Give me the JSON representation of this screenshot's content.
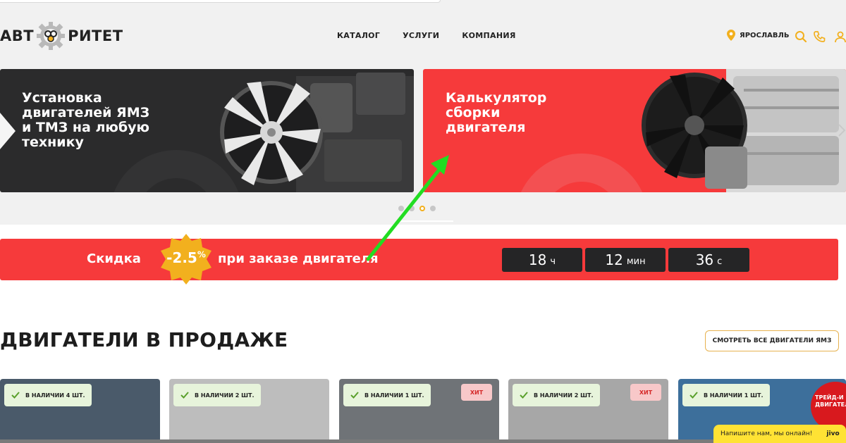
{
  "header": {
    "logo_left": "АВТ",
    "logo_right": "РИТЕТ",
    "nav": [
      "КАТАЛОГ",
      "УСЛУГИ",
      "КОМПАНИЯ"
    ],
    "city": "ЯРОСЛАВЛЬ",
    "icons": [
      "location-pin-icon",
      "search-icon",
      "phone-icon",
      "user-icon"
    ]
  },
  "slides": [
    {
      "title_lines": [
        "Установка",
        "двигателей ЯМЗ",
        "и ТМЗ на любую",
        "технику"
      ]
    },
    {
      "title_lines": [
        "Калькулятор",
        "сборки",
        "двигателя"
      ]
    }
  ],
  "carousel": {
    "dots": 4,
    "active": 3
  },
  "promo": {
    "before": "Скидка",
    "badge": "-2.5",
    "badge_suffix": "%",
    "after": "при заказе двигателя",
    "timer": [
      {
        "num": "18",
        "unit": "ч"
      },
      {
        "num": "12",
        "unit": "мин"
      },
      {
        "num": "36",
        "unit": "с"
      }
    ]
  },
  "section": {
    "title": "ДВИГАТЕЛИ В ПРОДАЖЕ",
    "see_all": "СМОТРЕТЬ ВСЕ ДВИГАТЕЛИ ЯМЗ"
  },
  "cards": [
    {
      "stock": "В НАЛИЧИИ 4 ШТ.",
      "hit": ""
    },
    {
      "stock": "В НАЛИЧИИ 2 ШТ.",
      "hit": ""
    },
    {
      "stock": "В НАЛИЧИИ 1 ШТ.",
      "hit": "ХИТ"
    },
    {
      "stock": "В НАЛИЧИИ 2 ШТ.",
      "hit": "ХИТ"
    },
    {
      "stock": "В НАЛИЧИИ 1 ШТ.",
      "hit": ""
    }
  ],
  "tradein": [
    "ТРЕЙД-И",
    "ДВИГАТЕЛ"
  ],
  "chat": {
    "text": "Напишите нам, мы онлайн!",
    "brand": "jivo"
  },
  "colors": {
    "red": "#f63a3b",
    "accent": "#f2b01e",
    "dark": "#2b2b2c",
    "annotation": "#22dd22"
  }
}
